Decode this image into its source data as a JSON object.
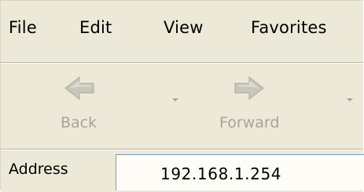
{
  "menu": {
    "items": [
      {
        "label": "File"
      },
      {
        "label": "Edit"
      },
      {
        "label": "View"
      },
      {
        "label": "Favorites"
      }
    ]
  },
  "toolbar": {
    "back": {
      "label": "Back",
      "icon": "back-arrow-icon"
    },
    "forward": {
      "label": "Forward",
      "icon": "forward-arrow-icon"
    }
  },
  "address": {
    "label": "Address",
    "value": "192.168.1.254"
  },
  "colors": {
    "chrome": "#ece9d8",
    "disabled_text": "#a6a39a",
    "input_bg": "#fdfcf6"
  }
}
